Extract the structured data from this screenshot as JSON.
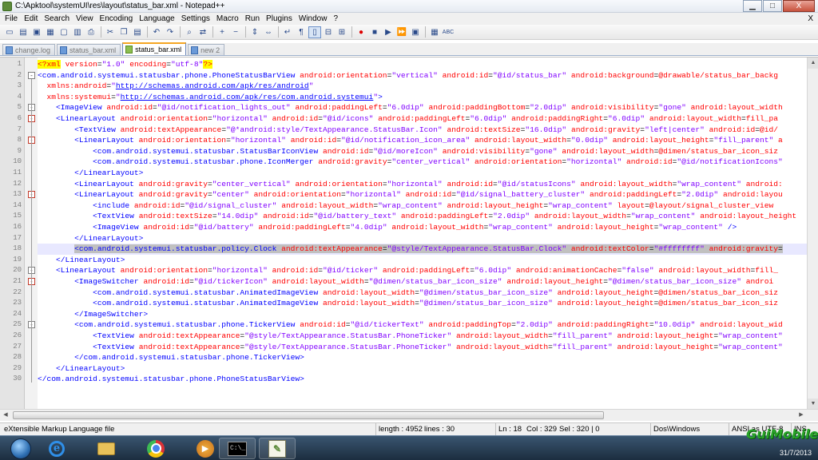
{
  "window": {
    "title": "C:\\Apktool\\systemUI\\res\\layout\\status_bar.xml - Notepad++",
    "minimize": "▁",
    "maximize": "□",
    "close": "X"
  },
  "menu": [
    "File",
    "Edit",
    "Search",
    "View",
    "Encoding",
    "Language",
    "Settings",
    "Macro",
    "Run",
    "Plugins",
    "Window",
    "?"
  ],
  "menu_close": "X",
  "toolbar": {
    "buttons": [
      "new",
      "open",
      "save",
      "save-all",
      "close",
      "close-all",
      "print",
      "cut",
      "copy",
      "paste",
      "undo",
      "redo",
      "find",
      "replace",
      "zoom-in",
      "zoom-out",
      "sync-v",
      "sync-h",
      "word-wrap",
      "all-chars",
      "indent-guide",
      "fold",
      "unfold",
      "doc-map",
      "record",
      "stop",
      "play",
      "play-multiple",
      "save-macro",
      "show-panel",
      "spellcheck"
    ]
  },
  "tabs": [
    {
      "label": "change.log",
      "active": false
    },
    {
      "label": "status_bar.xml",
      "active": false
    },
    {
      "label": "status_bar.xml",
      "active": true
    },
    {
      "label": "new 2",
      "active": false
    }
  ],
  "editor": {
    "current_line": 18,
    "lines": [
      "<?xml version=\"1.0\" encoding=\"utf-8\"?>",
      "<com.android.systemui.statusbar.phone.PhoneStatusBarView android:orientation=\"vertical\" android:id=\"@id/status_bar\" android:background=\"@drawable/status_bar_backg",
      "  xmlns:android=\"http://schemas.android.com/apk/res/android\"",
      "  xmlns:systemui=\"http://schemas.android.com/apk/res/com.android.systemui\">",
      "    <ImageView android:id=\"@id/notification_lights_out\" android:paddingLeft=\"6.0dip\" android:paddingBottom=\"2.0dip\" android:visibility=\"gone\" android:layout_width",
      "    <LinearLayout android:orientation=\"horizontal\" android:id=\"@id/icons\" android:paddingLeft=\"6.0dip\" android:paddingRight=\"6.0dip\" android:layout_width=\"fill_pa",
      "        <TextView android:textAppearance=\"@*android:style/TextAppearance.StatusBar.Icon\" android:textSize=\"16.0dip\" android:gravity=\"left|center\" android:id=\"@id/",
      "        <LinearLayout android:orientation=\"horizontal\" android:id=\"@id/notification_icon_area\" android:layout_width=\"0.0dip\" android:layout_height=\"fill_parent\" a",
      "            <com.android.systemui.statusbar.StatusBarIconView android:id=\"@id/moreIcon\" android:visibility=\"gone\" android:layout_width=\"@dimen/status_bar_icon_siz",
      "            <com.android.systemui.statusbar.phone.IconMerger android:gravity=\"center_vertical\" android:orientation=\"horizontal\" android:id=\"@id/notificationIcons\"",
      "        </LinearLayout>",
      "        <LinearLayout android:gravity=\"center_vertical\" android:orientation=\"horizontal\" android:id=\"@id/statusIcons\" android:layout_width=\"wrap_content\" android:",
      "        <LinearLayout android:gravity=\"center\" android:orientation=\"horizontal\" android:id=\"@id/signal_battery_cluster\" android:paddingLeft=\"2.0dip\" android:layou",
      "            <include android:id=\"@id/signal_cluster\" android:layout_width=\"wrap_content\" android:layout_height=\"wrap_content\" layout=\"@layout/signal_cluster_view",
      "            <TextView android:textSize=\"14.0dip\" android:id=\"@id/battery_text\" android:paddingLeft=\"2.0dip\" android:layout_width=\"wrap_content\" android:layout_height",
      "            <ImageView android:id=\"@id/battery\" android:paddingLeft=\"4.0dip\" android:layout_width=\"wrap_content\" android:layout_height=\"wrap_content\" />",
      "        </LinearLayout>",
      "        <com.android.systemui.statusbar.policy.Clock android:textAppearance=\"@style/TextAppearance.StatusBar.Clock\" android:textColor=\"#ffffffff\" android:gravity=",
      "    </LinearLayout>",
      "    <LinearLayout android:orientation=\"horizontal\" android:id=\"@id/ticker\" android:paddingLeft=\"6.0dip\" android:animationCache=\"false\" android:layout_width=\"fill_",
      "        <ImageSwitcher android:id=\"@id/tickerIcon\" android:layout_width=\"@dimen/status_bar_icon_size\" android:layout_height=\"@dimen/status_bar_icon_size\" androi",
      "            <com.android.systemui.statusbar.AnimatedImageView android:layout_width=\"@dimen/status_bar_icon_size\" android:layout_height=\"@dimen/status_bar_icon_siz",
      "            <com.android.systemui.statusbar.AnimatedImageView android:layout_width=\"@dimen/status_bar_icon_size\" android:layout_height=\"@dimen/status_bar_icon_siz",
      "        </ImageSwitcher>",
      "        <com.android.systemui.statusbar.phone.TickerView android:id=\"@id/tickerText\" android:paddingTop=\"2.0dip\" android:paddingRight=\"10.0dip\" android:layout_wid",
      "            <TextView android:textAppearance=\"@style/TextAppearance.StatusBar.PhoneTicker\" android:layout_width=\"fill_parent\" android:layout_height=\"wrap_content\"",
      "            <TextView android:textAppearance=\"@style/TextAppearance.StatusBar.PhoneTicker\" android:layout_width=\"fill_parent\" android:layout_height=\"wrap_content\"",
      "        </com.android.systemui.statusbar.phone.TickerView>",
      "    </LinearLayout>",
      "</com.android.systemui.statusbar.phone.PhoneStatusBarView>"
    ],
    "folds": {
      "2": "-",
      "5": "-",
      "6": "-",
      "8": "-",
      "13": "-",
      "20": "-",
      "21": "-",
      "25": "-"
    },
    "red_folds": [
      6,
      8,
      13,
      21
    ]
  },
  "statusbar": {
    "file_type": "eXtensible Markup Language file",
    "length": "length : 4952",
    "lines": "lines : 30",
    "ln": "Ln : 18",
    "col": "Col : 329",
    "sel": "Sel : 320 | 0",
    "eol": "Dos\\Windows",
    "encoding": "ANSI as UTF-8",
    "mode": "INS"
  },
  "taskbar": {
    "apps": [
      "internet-explorer",
      "file-explorer",
      "chrome",
      "media-player",
      "command-prompt",
      "notepad-plus-plus"
    ],
    "date": "31/7/2013"
  },
  "watermark": {
    "text": "GuiMobile"
  },
  "colors": {
    "tag": "#0000ff",
    "attribute": "#ff0000",
    "value": "#8000ff",
    "current_line": "#e8e8ff",
    "active_tab_accent": "#f5a623"
  }
}
